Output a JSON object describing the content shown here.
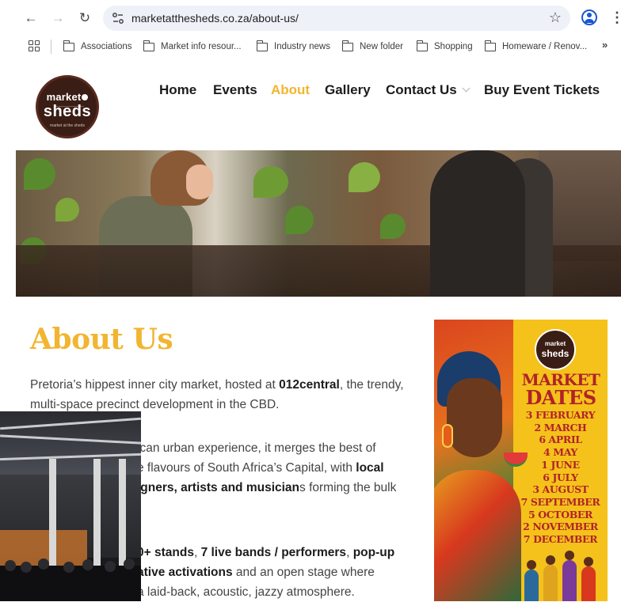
{
  "browser": {
    "url": "marketatthesheds.co.za/about-us/",
    "bookmarks": [
      {
        "label": "Associations"
      },
      {
        "label": "Market info resour..."
      },
      {
        "label": "Industry news"
      },
      {
        "label": "New folder"
      },
      {
        "label": "Shopping"
      },
      {
        "label": "Homeware / Renov..."
      }
    ],
    "more": "»"
  },
  "logo": {
    "line1": "market",
    "line2": "sheds",
    "line3": "market at the sheds"
  },
  "nav": [
    {
      "label": "Home"
    },
    {
      "label": "Events"
    },
    {
      "label": "About",
      "active": true
    },
    {
      "label": "Gallery"
    },
    {
      "label": "Contact Us",
      "has_dropdown": true
    },
    {
      "label": "Buy Event Tickets"
    }
  ],
  "about": {
    "title": "About Us",
    "p1_pre": "Pretoria’s hippest inner city market, hosted at ",
    "p1_bold": "012central",
    "p1_post": ", the trendy, multi-space precinct development in the CBD.",
    "p2_a": "ican urban experience, it merges the best of",
    "p2_b": "e flavours of South Africa’s Capital, with ",
    "p2_bold1": "local",
    "p2_bold2": "igners, artists and musician",
    "p2_c": "s forming the bulk",
    "p3_bold1": "0+ stands",
    "p3_mid": ", ",
    "p3_bold2": "7 live bands / performers",
    "p3_mid2": ", ",
    "p3_bold3": "pop-up",
    "p3_bold4": "ative activations",
    "p3_tail": " and an open stage where",
    "p3_last": "a laid-back, acoustic, jazzy atmosphere."
  },
  "poster": {
    "logo_top": "market",
    "logo_bottom": "sheds",
    "heading1": "MARKET",
    "heading2": "DATES",
    "dates": [
      "3 FEBRUARY",
      "2 MARCH",
      "6 APRIL",
      "4 MAY",
      "1 JUNE",
      "6 JULY",
      "3 AUGUST",
      "7 SEPTEMBER",
      "5 OCTOBER",
      "2 NOVEMBER",
      "7 DECEMBER"
    ]
  },
  "colors": {
    "accent": "#f2b531",
    "poster_bg": "#f4c21a",
    "poster_text": "#b1222a",
    "body_text": "#444444"
  }
}
